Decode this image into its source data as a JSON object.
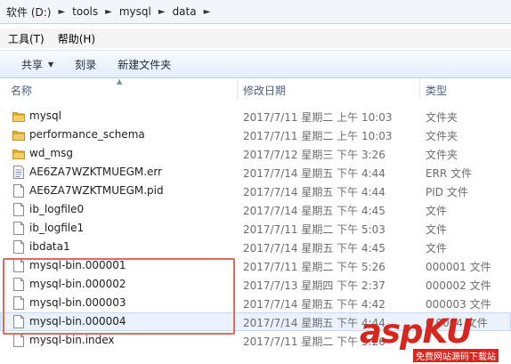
{
  "address": {
    "crumbs": [
      "软件 (D:)",
      "tools",
      "mysql",
      "data"
    ]
  },
  "menu": {
    "tools": "工具(T)",
    "help": "帮助(H)"
  },
  "toolbar": {
    "share": "共享",
    "burn": "刻录",
    "new_folder": "新建文件夹"
  },
  "columns": {
    "name": "名称",
    "date": "修改日期",
    "type": "类型"
  },
  "files": [
    {
      "name": "mysql",
      "date": "2017/7/11 星期二 上午 10:03",
      "type": "文件夹",
      "icon": "folder-icon"
    },
    {
      "name": "performance_schema",
      "date": "2017/7/11 星期二 上午 10:03",
      "type": "文件夹",
      "icon": "folder-icon"
    },
    {
      "name": "wd_msg",
      "date": "2017/7/12 星期三 下午 3:26",
      "type": "文件夹",
      "icon": "folder-icon"
    },
    {
      "name": "AE6ZA7WZKTMUEGM.err",
      "date": "2017/7/14 星期五 下午 4:44",
      "type": "ERR 文件",
      "icon": "text-file-icon"
    },
    {
      "name": "AE6ZA7WZKTMUEGM.pid",
      "date": "2017/7/14 星期五 下午 4:44",
      "type": "PID 文件",
      "icon": "file-icon"
    },
    {
      "name": "ib_logfile0",
      "date": "2017/7/14 星期五 下午 4:45",
      "type": "文件",
      "icon": "file-icon"
    },
    {
      "name": "ib_logfile1",
      "date": "2017/7/11 星期二 下午 5:03",
      "type": "文件",
      "icon": "file-icon"
    },
    {
      "name": "ibdata1",
      "date": "2017/7/14 星期五 下午 4:45",
      "type": "文件",
      "icon": "file-icon"
    },
    {
      "name": "mysql-bin.000001",
      "date": "2017/7/11 星期二 下午 5:26",
      "type": "000001 文件",
      "icon": "file-icon"
    },
    {
      "name": "mysql-bin.000002",
      "date": "2017/7/13 星期四 下午 2:37",
      "type": "000002 文件",
      "icon": "file-icon"
    },
    {
      "name": "mysql-bin.000003",
      "date": "2017/7/14 星期五 下午 4:42",
      "type": "000003 文件",
      "icon": "file-icon"
    },
    {
      "name": "mysql-bin.000004",
      "date": "2017/7/14 星期五 下午 4:44",
      "type": "0 0004 文件",
      "icon": "file-icon"
    },
    {
      "name": "mysql-bin.index",
      "date": "2017/7/11 星期二 下午 5:26",
      "type": "",
      "icon": "file-icon"
    }
  ],
  "selected_index": 11,
  "watermark": {
    "text": "aspKU",
    "sub": "免费网站源码下载站"
  },
  "colors": {
    "folder": "#e8b93a",
    "highlight": "#e06a5e",
    "watermark": "#d9261c"
  }
}
